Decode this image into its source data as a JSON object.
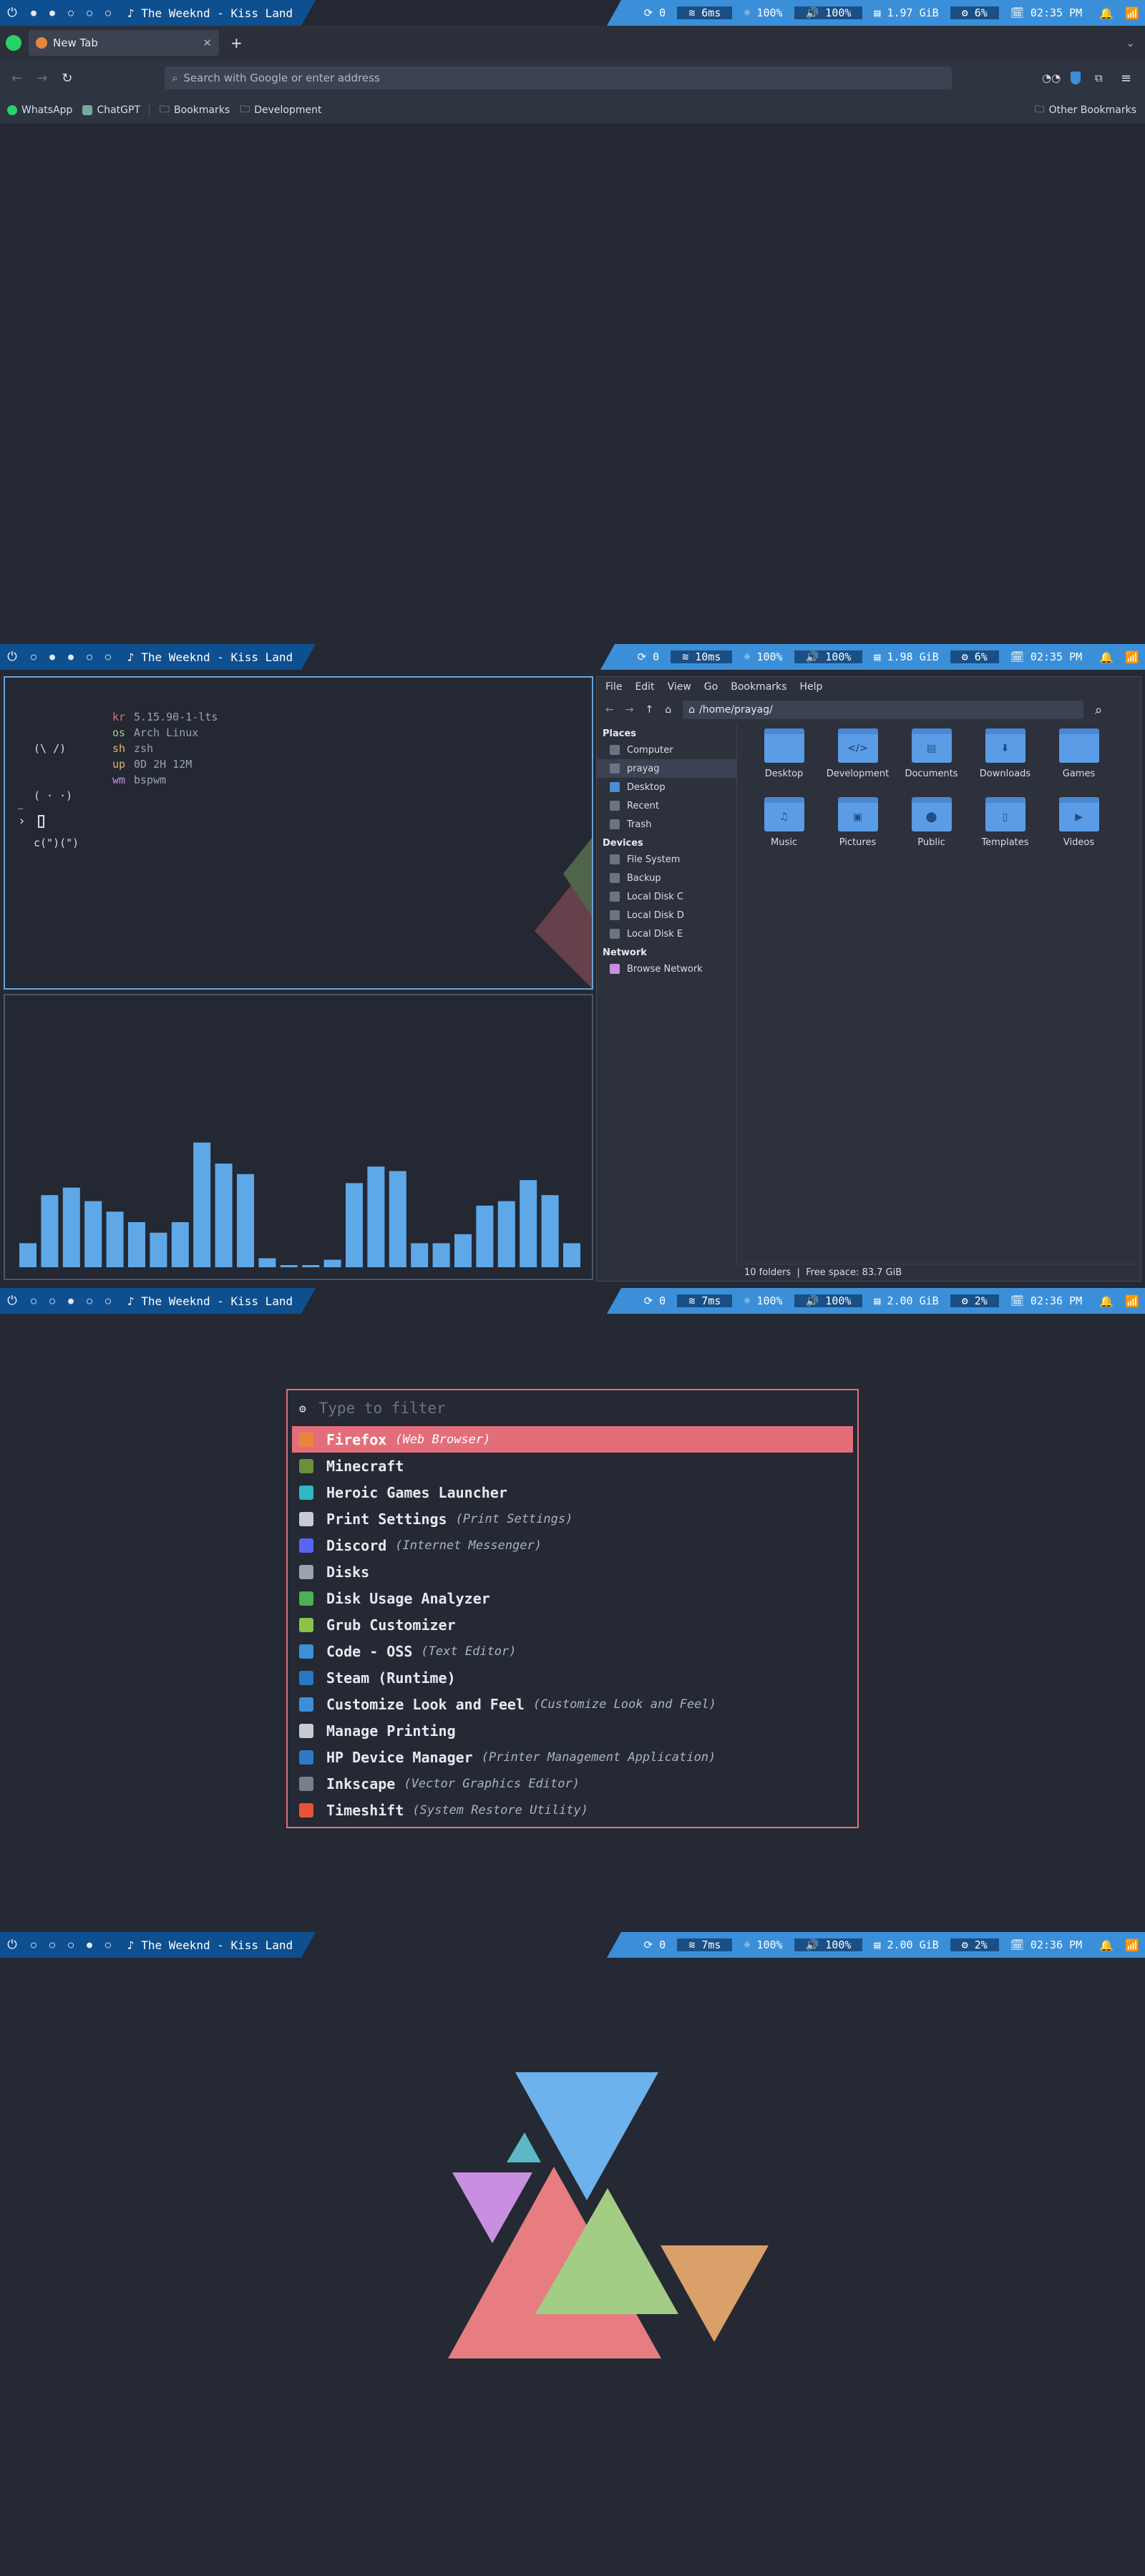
{
  "bars": [
    {
      "song": "The Weeknd - Kiss Land",
      "updates": "0",
      "ping": "6ms",
      "brightness": "100%",
      "volume": "100%",
      "memory": "1.97 GiB",
      "cpu": "6%",
      "time": "02:35 PM"
    },
    {
      "song": "The Weeknd - Kiss Land",
      "updates": "0",
      "ping": "10ms",
      "brightness": "100%",
      "volume": "100%",
      "memory": "1.98 GiB",
      "cpu": "6%",
      "time": "02:35 PM"
    },
    {
      "song": "The Weeknd - Kiss Land",
      "updates": "0",
      "ping": "7ms",
      "brightness": "100%",
      "volume": "100%",
      "memory": "2.00 GiB",
      "cpu": "2%",
      "time": "02:36 PM"
    },
    {
      "song": "The Weeknd - Kiss Land",
      "updates": "0",
      "ping": "7ms",
      "brightness": "100%",
      "volume": "100%",
      "memory": "2.00 GiB",
      "cpu": "2%",
      "time": "02:36 PM"
    }
  ],
  "browser": {
    "tab_title": "New Tab",
    "url_placeholder": "Search with Google or enter address",
    "bookmarks": [
      "WhatsApp",
      "ChatGPT",
      "Bookmarks",
      "Development"
    ],
    "other_bookmarks": "Other Bookmarks"
  },
  "fetch": {
    "art": [
      "(\\ /)",
      "( · ·)",
      "c(\")(\")"
    ],
    "rows": [
      {
        "key": "kr",
        "value": "5.15.90-1-lts",
        "color": "#e36e7a"
      },
      {
        "key": "os",
        "value": "Arch Linux",
        "color": "#a3d17a"
      },
      {
        "key": "sh",
        "value": "zsh",
        "color": "#e5b66f"
      },
      {
        "key": "up",
        "value": "0D 2H 12M",
        "color": "#e5b66f"
      },
      {
        "key": "wm",
        "value": "bspwm",
        "color": "#c88fe0"
      }
    ],
    "prompt": "›"
  },
  "visualizer": {
    "levels": [
      0.16,
      0.48,
      0.53,
      0.44,
      0.37,
      0.3,
      0.23,
      0.3,
      0.83,
      0.69,
      0.62,
      0.06,
      0.01,
      0.01,
      0.05,
      0.56,
      0.67,
      0.64,
      0.16,
      0.16,
      0.22,
      0.41,
      0.44,
      0.58,
      0.48,
      0.16
    ]
  },
  "filemanager": {
    "menu": [
      "File",
      "Edit",
      "View",
      "Go",
      "Bookmarks",
      "Help"
    ],
    "path": "/home/prayag/",
    "places_title": "Places",
    "places": [
      "Computer",
      "prayag",
      "Desktop",
      "Recent",
      "Trash"
    ],
    "devices_title": "Devices",
    "devices": [
      "File System",
      "Backup",
      "Local Disk C",
      "Local Disk D",
      "Local Disk E"
    ],
    "network_title": "Network",
    "network": [
      "Browse Network"
    ],
    "folders": [
      "Desktop",
      "Development",
      "Documents",
      "Downloads",
      "Games",
      "Music",
      "Pictures",
      "Public",
      "Templates",
      "Videos"
    ],
    "status": "10 folders  |  Free space: 83.7 GiB"
  },
  "launcher": {
    "placeholder": "Type to filter",
    "items": [
      {
        "name": "Firefox",
        "sub": "(Web Browser)",
        "icon": "#e8873c"
      },
      {
        "name": "Minecraft",
        "sub": "",
        "icon": "#6b8f3a"
      },
      {
        "name": "Heroic Games Launcher",
        "sub": "",
        "icon": "#2fb7c4"
      },
      {
        "name": "Print Settings",
        "sub": "(Print Settings)",
        "icon": "#c7ccd4"
      },
      {
        "name": "Discord",
        "sub": "(Internet Messenger)",
        "icon": "#5865f2"
      },
      {
        "name": "Disks",
        "sub": "",
        "icon": "#9aa3b0"
      },
      {
        "name": "Disk Usage Analyzer",
        "sub": "",
        "icon": "#4caf50"
      },
      {
        "name": "Grub Customizer",
        "sub": "",
        "icon": "#8bc34a"
      },
      {
        "name": "Code - OSS",
        "sub": "(Text Editor)",
        "icon": "#3c8fd8"
      },
      {
        "name": "Steam (Runtime)",
        "sub": "",
        "icon": "#2a76c6"
      },
      {
        "name": "Customize Look and Feel",
        "sub": "(Customize Look and Feel)",
        "icon": "#3b8fd8"
      },
      {
        "name": "Manage Printing",
        "sub": "",
        "icon": "#c7ccd4"
      },
      {
        "name": "HP Device Manager",
        "sub": "(Printer Management Application)",
        "icon": "#2f78c4"
      },
      {
        "name": "Inkscape",
        "sub": "(Vector Graphics Editor)",
        "icon": "#777f8c"
      },
      {
        "name": "Timeshift",
        "sub": "(System Restore Utility)",
        "icon": "#e5533d"
      }
    ]
  }
}
